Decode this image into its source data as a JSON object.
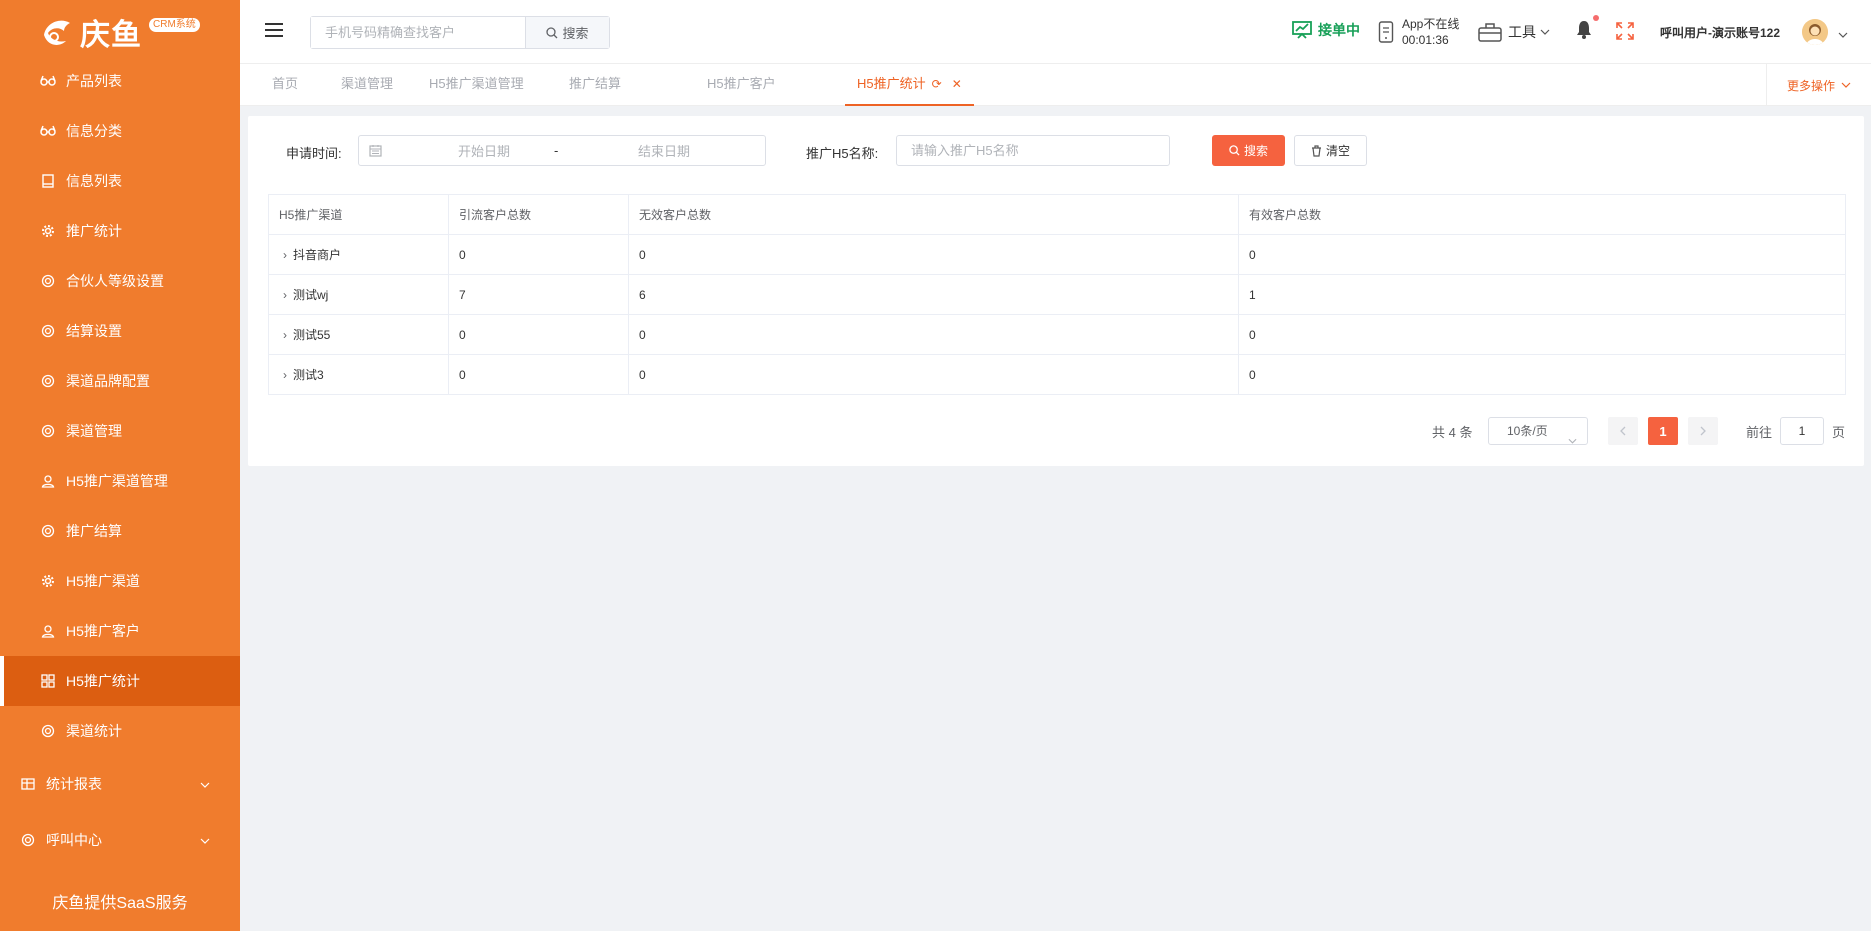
{
  "brand": {
    "logo_text": "庆鱼",
    "badge": "CRM系统"
  },
  "sidebar": {
    "items": [
      {
        "label": "产品列表",
        "icon": "glasses-icon"
      },
      {
        "label": "信息分类",
        "icon": "glasses-icon"
      },
      {
        "label": "信息列表",
        "icon": "book-icon"
      },
      {
        "label": "推广统计",
        "icon": "gear-icon"
      },
      {
        "label": "合伙人等级设置",
        "icon": "gear-icon"
      },
      {
        "label": "结算设置",
        "icon": "gear-icon"
      },
      {
        "label": "渠道品牌配置",
        "icon": "gear-icon"
      },
      {
        "label": "渠道管理",
        "icon": "gear-icon"
      },
      {
        "label": "H5推广渠道管理",
        "icon": "user-icon"
      },
      {
        "label": "推广结算",
        "icon": "gear-icon"
      },
      {
        "label": "H5推广渠道",
        "icon": "gear-icon"
      },
      {
        "label": "H5推广客户",
        "icon": "user-icon"
      },
      {
        "label": "H5推广统计",
        "icon": "grid-icon",
        "active": true
      },
      {
        "label": "渠道统计",
        "icon": "gear-icon"
      }
    ],
    "groups": [
      {
        "label": "统计报表",
        "icon": "table-icon"
      },
      {
        "label": "呼叫中心",
        "icon": "gear-icon"
      }
    ],
    "footer": "庆鱼提供SaaS服务"
  },
  "header": {
    "search_placeholder": "手机号码精确查找客户",
    "search_button": "搜索",
    "receiving_status": "接单中",
    "app_status_line1": "App不在线",
    "app_status_line2": "00:01:36",
    "tools_label": "工具",
    "user_name": "呼叫用户-演示账号122"
  },
  "tabs": [
    {
      "label": "首页"
    },
    {
      "label": "渠道管理"
    },
    {
      "label": "H5推广渠道管理"
    },
    {
      "label": "推广结算"
    },
    {
      "label": "H5推广客户"
    },
    {
      "label": "H5推广统计",
      "active": true
    }
  ],
  "more_ops": "更多操作",
  "filters": {
    "date_label": "申请时间:",
    "start_placeholder": "开始日期",
    "range_separator": "-",
    "end_placeholder": "结束日期",
    "name_label": "推广H5名称:",
    "name_placeholder": "请输入推广H5名称",
    "search_button": "搜索",
    "clear_button": "清空"
  },
  "table": {
    "columns": [
      "H5推广渠道",
      "引流客户总数",
      "无效客户总数",
      "有效客户总数"
    ],
    "rows": [
      [
        "抖音商户",
        "0",
        "0",
        "0"
      ],
      [
        "测试wj",
        "7",
        "6",
        "1"
      ],
      [
        "测试55",
        "0",
        "0",
        "0"
      ],
      [
        "测试3",
        "0",
        "0",
        "0"
      ]
    ]
  },
  "pagination": {
    "total_text": "共 4 条",
    "page_size": "10条/页",
    "current_page": "1",
    "goto_label": "前往",
    "goto_value": "1",
    "page_suffix": "页"
  },
  "colors": {
    "sidebar": "#f07c2d",
    "sidebar_active": "#dc5e11",
    "accent": "#f5623f",
    "tab_active": "#ee6325",
    "receiving": "#18a058"
  }
}
